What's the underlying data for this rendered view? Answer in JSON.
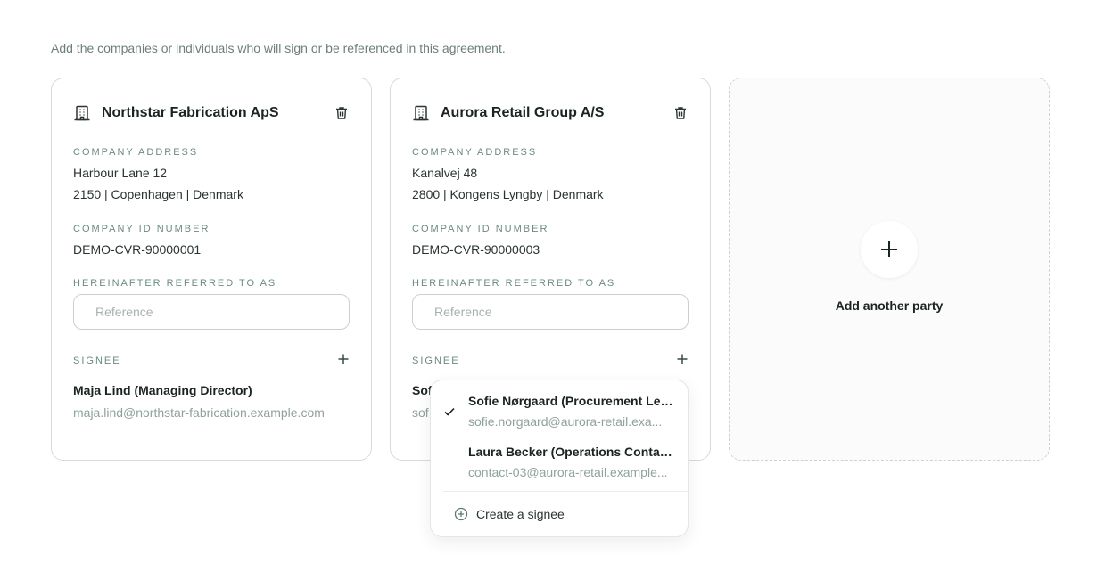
{
  "intro_text": "Add the companies or individuals who will sign or be referenced in this agreement.",
  "labels": {
    "company_address": "Company address",
    "company_id": "Company ID number",
    "referred_as": "Hereinafter referred to as",
    "signee": "Signee",
    "reference_placeholder": "Reference"
  },
  "parties": [
    {
      "name": "Northstar Fabrication ApS",
      "address_line1": "Harbour Lane 12",
      "address_line2": "2150 | Copenhagen | Denmark",
      "company_id": "DEMO-CVR-90000001",
      "reference_value": "",
      "signee_name": "Maja Lind (Managing Director)",
      "signee_email": "maja.lind@northstar-fabrication.example.com"
    },
    {
      "name": "Aurora Retail Group A/S",
      "address_line1": "Kanalvej 48",
      "address_line2": "2800 | Kongens Lyngby | Denmark",
      "company_id": "DEMO-CVR-90000003",
      "reference_value": "",
      "signee_name": "Sof",
      "signee_email": "sof"
    }
  ],
  "add_party": {
    "label": "Add another party"
  },
  "signee_dropdown": {
    "options": [
      {
        "name": "Sofie Nørgaard (Procurement Lea...",
        "email": "sofie.norgaard@aurora-retail.exa...",
        "selected": true
      },
      {
        "name": "Laura Becker (Operations Contact)",
        "email": "contact-03@aurora-retail.example...",
        "selected": false
      }
    ],
    "create_label": "Create a signee"
  },
  "icons": {
    "building": "building-icon",
    "trash": "trash-icon",
    "plus": "plus-icon",
    "check": "check-icon",
    "plus_circle": "plus-circle-icon"
  },
  "colors": {
    "accent_label": "#6b8a82",
    "muted_text": "#8fa29c",
    "border": "#d5dbd8"
  }
}
